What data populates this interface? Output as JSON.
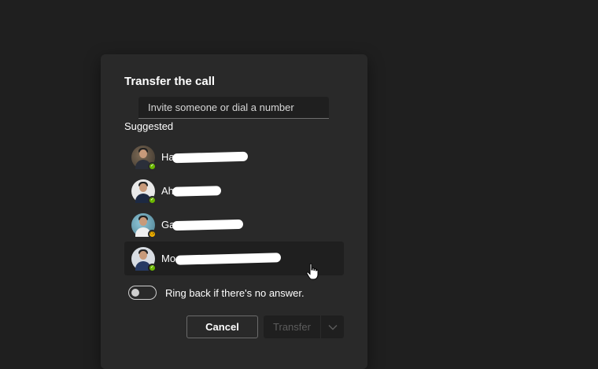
{
  "dialog": {
    "title": "Transfer the call",
    "search": {
      "placeholder": "Invite someone or dial a number",
      "value": ""
    },
    "section_label": "Suggested",
    "people": [
      {
        "name_prefix": "Ha",
        "status": "available"
      },
      {
        "name_prefix": "Ah",
        "status": "available"
      },
      {
        "name_prefix": "Ga",
        "status": "away"
      },
      {
        "name_prefix": "Mo",
        "status": "available"
      }
    ],
    "ring_back": {
      "label": "Ring back if there's no answer.",
      "checked": false
    },
    "cancel_label": "Cancel",
    "transfer_label": "Transfer"
  },
  "colors": {
    "available": "#6bb700",
    "away": "#f8b600",
    "dialog_bg": "#292929",
    "page_bg": "#1f1f1f"
  },
  "icons": {
    "presence_available": "check-icon",
    "presence_away": "clock-icon",
    "transfer_dropdown": "chevron-down-icon",
    "cursor": "hand-pointer-icon"
  }
}
